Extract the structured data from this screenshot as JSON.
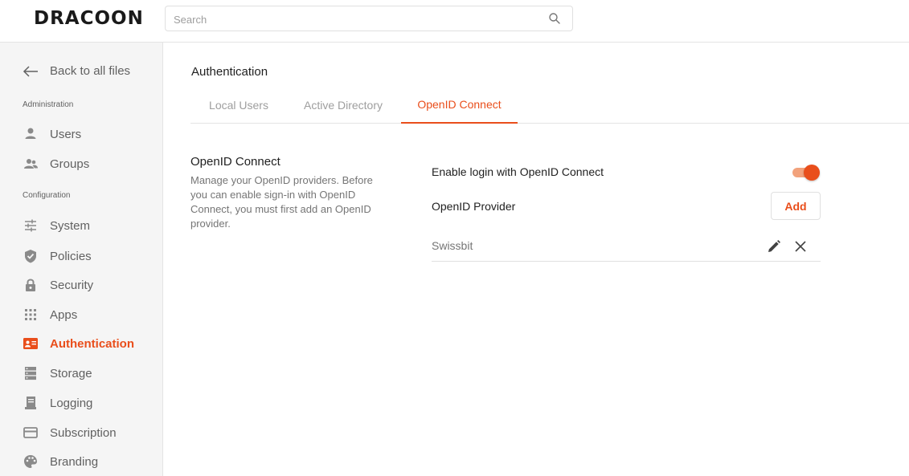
{
  "app": {
    "logo_text": "DRACOON"
  },
  "search": {
    "placeholder": "Search"
  },
  "sidebar": {
    "back_label": "Back to all files",
    "section_administration": "Administration",
    "section_configuration": "Configuration",
    "items": [
      {
        "label": "Users",
        "icon": "user-icon"
      },
      {
        "label": "Groups",
        "icon": "groups-icon"
      },
      {
        "label": "System",
        "icon": "sliders-icon"
      },
      {
        "label": "Policies",
        "icon": "shield-check-icon"
      },
      {
        "label": "Security",
        "icon": "lock-icon"
      },
      {
        "label": "Apps",
        "icon": "apps-grid-icon"
      },
      {
        "label": "Authentication",
        "icon": "id-card-icon",
        "active": true
      },
      {
        "label": "Storage",
        "icon": "storage-icon"
      },
      {
        "label": "Logging",
        "icon": "logging-icon"
      },
      {
        "label": "Subscription",
        "icon": "credit-card-icon"
      },
      {
        "label": "Branding",
        "icon": "palette-icon"
      }
    ]
  },
  "main": {
    "title": "Authentication",
    "tabs": [
      {
        "label": "Local Users",
        "active": false
      },
      {
        "label": "Active Directory",
        "active": false
      },
      {
        "label": "OpenID Connect",
        "active": true
      }
    ],
    "section": {
      "title": "OpenID Connect",
      "description": "Manage your OpenID providers. Before you can enable sign-in with OpenID Connect, you must first add an OpenID provider."
    },
    "enable_login_label": "Enable login with OpenID Connect",
    "enable_login_on": true,
    "provider_label": "OpenID Provider",
    "add_label": "Add",
    "providers": [
      {
        "name": "Swissbit"
      }
    ]
  },
  "colors": {
    "accent": "#e94e1b",
    "toggle_track": "#f2a27c",
    "sidebar_bg": "#f5f5f5",
    "icon_gray": "#8a8a8a"
  }
}
